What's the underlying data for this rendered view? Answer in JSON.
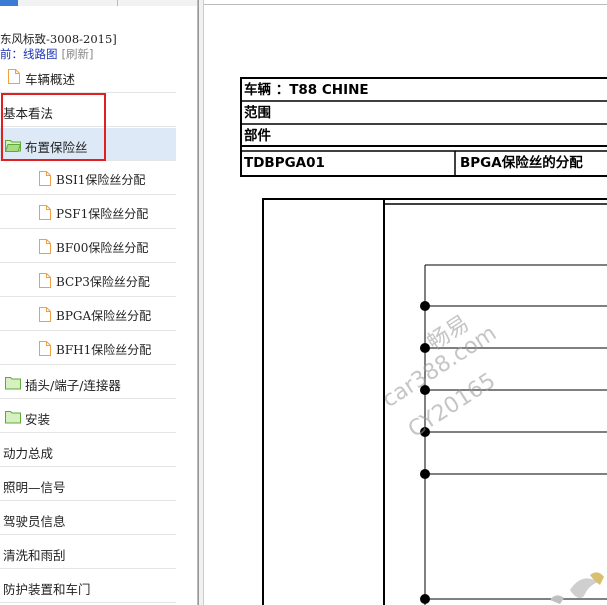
{
  "sidebar": {
    "doc_title": "东风标致-3008-2015]",
    "nav_prefix": "前：",
    "nav_path": "线路图",
    "nav_refresh": "[刷新]",
    "items": [
      {
        "label": "车辆概述",
        "icon": "file-icon"
      },
      {
        "label": "基本看法",
        "icon": ""
      },
      {
        "label": "布置保险丝",
        "icon": "folder-open-icon"
      },
      {
        "label": "BSI1保险丝分配",
        "icon": "file-icon"
      },
      {
        "label": "PSF1保险丝分配",
        "icon": "file-icon"
      },
      {
        "label": "BF00保险丝分配",
        "icon": "file-icon"
      },
      {
        "label": "BCP3保险丝分配",
        "icon": "file-icon"
      },
      {
        "label": "BPGA保险丝分配",
        "icon": "file-icon"
      },
      {
        "label": "BFH1保险丝分配",
        "icon": "file-icon"
      },
      {
        "label": "插头/端子/连接器",
        "icon": "folder-icon"
      },
      {
        "label": "安装",
        "icon": "folder-icon"
      },
      {
        "label": "动力总成",
        "icon": ""
      },
      {
        "label": "照明—信号",
        "icon": ""
      },
      {
        "label": "驾驶员信息",
        "icon": ""
      },
      {
        "label": "清洗和雨刮",
        "icon": ""
      },
      {
        "label": "防护装置和车门",
        "icon": ""
      }
    ]
  },
  "document": {
    "vehicle_label": "车辆 ：T88 CHINE",
    "scope_label": "范围",
    "part_label": "部件",
    "code": "TDBPGA01",
    "title": "BPGA保险丝的分配"
  },
  "watermark": {
    "line1": "畅易",
    "line2": "car388.com",
    "line3": "CY20165"
  },
  "colors": {
    "highlight": "#e02020",
    "selected_row": "#dde9f7",
    "link": "#1a33b5",
    "folder": "#7ec850",
    "file": "#f0a040"
  }
}
